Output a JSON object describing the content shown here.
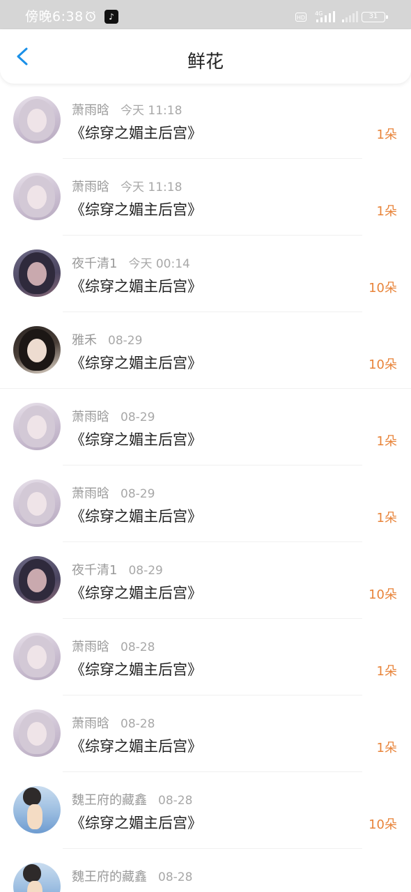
{
  "status_bar": {
    "time": "傍晚6:38",
    "alarm_icon": "alarm-icon",
    "app_icon": "tiktok-icon",
    "hd": "HD",
    "network": "4G",
    "battery": "31"
  },
  "nav": {
    "back_icon": "chevron-left-icon",
    "title": "鲜花"
  },
  "colors": {
    "accent_blue": "#1a90e8",
    "count_orange": "#e8843a",
    "status_bar_bg": "#d6d6d6"
  },
  "items": [
    {
      "avatar": "girl",
      "user": "萧雨晗",
      "time": "今天 11:18",
      "book": "《综穿之媚主后宫》",
      "count": "1朵"
    },
    {
      "avatar": "girl",
      "user": "萧雨晗",
      "time": "今天 11:18",
      "book": "《综穿之媚主后宫》",
      "count": "1朵"
    },
    {
      "avatar": "boy",
      "user": "夜千清1",
      "time": "今天 00:14",
      "book": "《综穿之媚主后宫》",
      "count": "10朵"
    },
    {
      "avatar": "lady",
      "user": "雅禾",
      "time": "08-29",
      "book": "《综穿之媚主后宫》",
      "count": "10朵"
    },
    {
      "avatar": "girl",
      "user": "萧雨晗",
      "time": "08-29",
      "book": "《综穿之媚主后宫》",
      "count": "1朵"
    },
    {
      "avatar": "girl",
      "user": "萧雨晗",
      "time": "08-29",
      "book": "《综穿之媚主后宫》",
      "count": "1朵"
    },
    {
      "avatar": "boy",
      "user": "夜千清1",
      "time": "08-29",
      "book": "《综穿之媚主后宫》",
      "count": "10朵"
    },
    {
      "avatar": "girl",
      "user": "萧雨晗",
      "time": "08-28",
      "book": "《综穿之媚主后宫》",
      "count": "1朵"
    },
    {
      "avatar": "girl",
      "user": "萧雨晗",
      "time": "08-28",
      "book": "《综穿之媚主后宫》",
      "count": "1朵"
    },
    {
      "avatar": "sea",
      "user": "魏王府的藏鑫",
      "time": "08-28",
      "book": "《综穿之媚主后宫》",
      "count": "10朵"
    },
    {
      "avatar": "sea",
      "user": "魏王府的藏鑫",
      "time": "08-28",
      "book": "",
      "count": ""
    }
  ]
}
